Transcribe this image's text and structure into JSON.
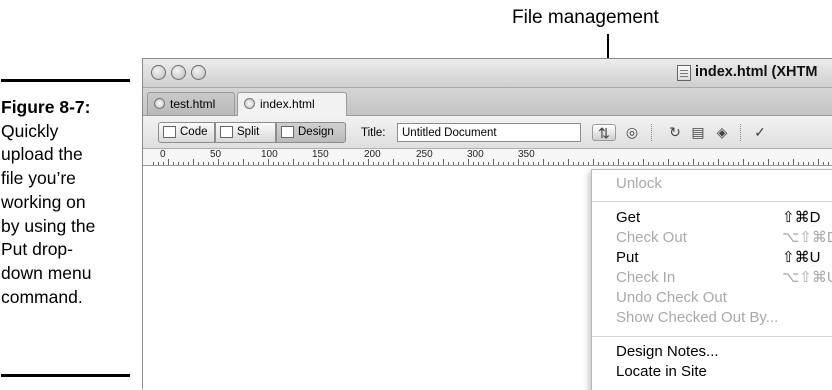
{
  "callout": {
    "label": "File management"
  },
  "caption": {
    "figure": "Figure 8-7:",
    "lines": [
      "Quickly",
      "upload the",
      "file you’re",
      "working on",
      "by using the",
      "Put drop-",
      "down menu",
      "command."
    ]
  },
  "window": {
    "title": "index.html (XHTM",
    "tabs": [
      {
        "label": "test.html"
      },
      {
        "label": "index.html"
      }
    ],
    "view_buttons": {
      "code": "Code",
      "split": "Split",
      "design": "Design"
    },
    "title_field": {
      "label": "Title:",
      "value": "Untitled Document"
    },
    "ruler": [
      "0",
      "50",
      "100",
      "150",
      "200",
      "250",
      "300",
      "350"
    ]
  },
  "menu": {
    "items": [
      {
        "label": "Unlock",
        "shortcut": "",
        "enabled": false
      },
      {
        "label": "Get",
        "shortcut": "⇧⌘D",
        "enabled": true
      },
      {
        "label": "Check Out",
        "shortcut": "⌥⇧⌘D",
        "enabled": false
      },
      {
        "label": "Put",
        "shortcut": "⇧⌘U",
        "enabled": true
      },
      {
        "label": "Check In",
        "shortcut": "⌥⇧⌘U",
        "enabled": false
      },
      {
        "label": "Undo Check Out",
        "shortcut": "",
        "enabled": false
      },
      {
        "label": "Show Checked Out By...",
        "shortcut": "",
        "enabled": false
      },
      {
        "label": "Design Notes...",
        "shortcut": "",
        "enabled": true
      },
      {
        "label": "Locate in Site",
        "shortcut": "",
        "enabled": true
      }
    ]
  }
}
